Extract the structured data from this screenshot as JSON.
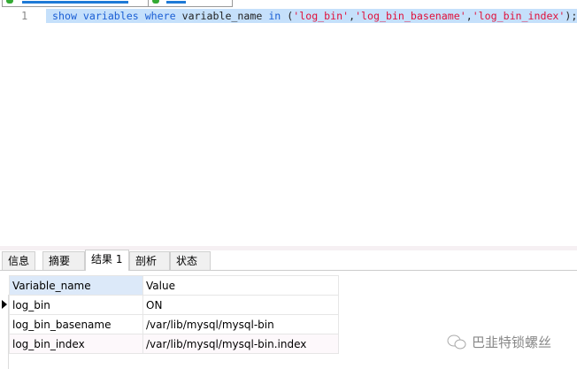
{
  "editor": {
    "line_number": "1",
    "sql": {
      "kw1": "show variables where",
      "ident": " variable_name ",
      "kw2": "in",
      "p1": " (",
      "s1": "'log_bin'",
      "c1": ",",
      "s2": "'log_bin_basename'",
      "c2": ",",
      "s3": "'log_bin_index'",
      "end": ");"
    }
  },
  "tabs": [
    "信息",
    "摘要",
    "结果 1",
    "剖析",
    "状态"
  ],
  "active_tab": "结果 1",
  "table": {
    "headers": [
      "Variable_name",
      "Value"
    ],
    "rows": [
      [
        "log_bin",
        "ON"
      ],
      [
        "log_bin_basename",
        "/var/lib/mysql/mysql-bin"
      ],
      [
        "log_bin_index",
        "/var/lib/mysql/mysql-bin.index"
      ]
    ]
  },
  "watermark": {
    "icon": "wechat-icon",
    "text": "巴韭特锁螺丝"
  },
  "colors": {
    "keyword": "#1a5ed4",
    "string": "#e0103a",
    "selection": "#c5e0fb"
  }
}
